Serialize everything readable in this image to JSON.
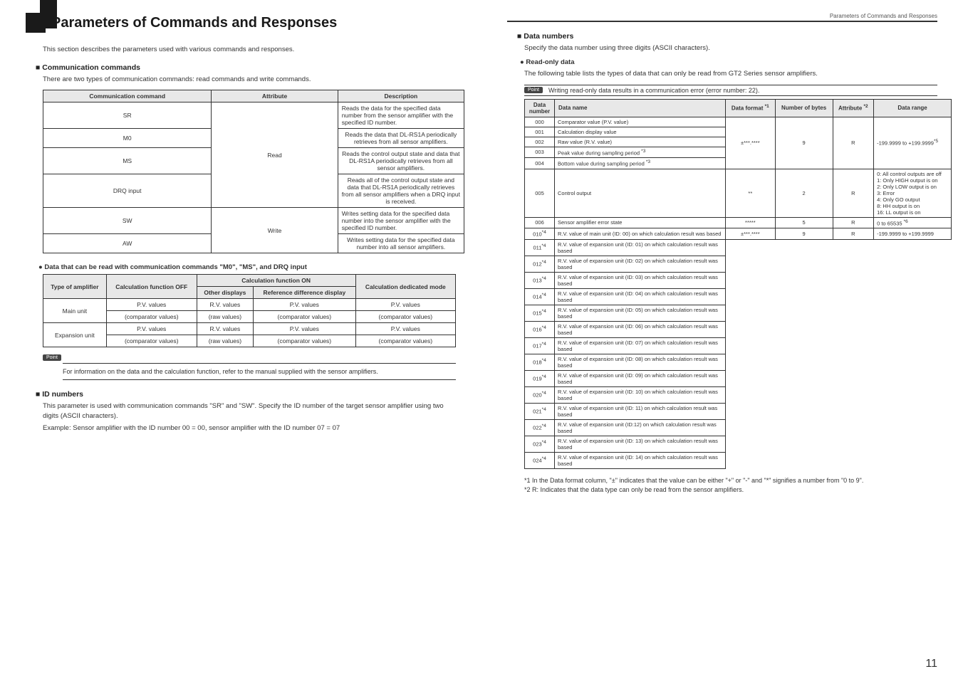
{
  "left": {
    "title": "Parameters of Commands and Responses",
    "intro": "This section describes the parameters used with various commands and responses.",
    "h_comm": "Communication commands",
    "comm_intro": "There are two types of communication commands: read commands and write commands.",
    "tbl1": {
      "h1": "Communication command",
      "h2": "Attribute",
      "h3": "Description",
      "rows": [
        {
          "c": "SR",
          "d": "Reads the data for the specified data number from the sensor amplifier with the specified ID number."
        },
        {
          "c": "M0",
          "d": "Reads the data that DL-RS1A periodically retrieves from all sensor amplifiers."
        },
        {
          "c": "MS",
          "d": "Reads the control output state and data that DL-RS1A periodically retrieves from all sensor amplifiers."
        },
        {
          "c": "DRQ input",
          "d": "Reads all of the control output state and data that DL-RS1A periodically retrieves from all sensor amplifiers when a DRQ input is received."
        }
      ],
      "attr_read": "Read",
      "write_rows": [
        {
          "c": "SW",
          "d": "Writes setting data for the specified data number into the sensor amplifier with the specified ID number."
        },
        {
          "c": "AW",
          "d": "Writes setting data for the specified data number into all sensor amplifiers."
        }
      ],
      "attr_write": "Write"
    },
    "sub_data": "Data that can be read with communication commands \"M0\", \"MS\", and DRQ input",
    "tbl2": {
      "h_type": "Type of amplifier",
      "h_calc_off": "Calculation function OFF",
      "h_calc_on": "Calculation function ON",
      "h_other": "Other displays",
      "h_ref": "Reference difference display",
      "h_dedicated": "Calculation dedicated mode",
      "r1_type": "Main unit",
      "r2_type": "Expansion unit",
      "pv": "P.V. values",
      "rv": "R.V. values",
      "comp": "(comparator values)",
      "raw": "(raw values)"
    },
    "point_label": "Point",
    "point_text": "For information on the data and the calculation function, refer to the manual supplied with the sensor amplifiers.",
    "h_id": "ID numbers",
    "id_p1": "This parameter is used with communication commands \"SR\" and \"SW\". Specify the ID number of the target sensor amplifier using two digits (ASCII characters).",
    "id_p2": "Example: Sensor amplifier with the ID number 00 = 00, sensor amplifier with the ID number 07 = 07"
  },
  "right": {
    "header": "Parameters of Commands and Responses",
    "h_data": "Data numbers",
    "data_intro": "Specify the data number using three digits (ASCII characters).",
    "sub_read": "Read-only data",
    "read_intro": "The following table lists the types of data that can only be read from GT2 Series sensor amplifiers.",
    "point_label": "Point",
    "point_text": "Writing read-only data results in a communication error (error number: 22).",
    "tbl3": {
      "h_num": "Data number",
      "h_name": "Data name",
      "h_fmt": "Data format",
      "h_fmt_sup": "*1",
      "h_bytes": "Number of bytes",
      "h_attr": "Attribute",
      "h_attr_sup": "*2",
      "h_range": "Data range",
      "g1": [
        {
          "n": "000",
          "name": "Comparator value (P.V. value)"
        },
        {
          "n": "001",
          "name": "Calculation display value"
        },
        {
          "n": "002",
          "name": "Raw value (R.V. value)"
        },
        {
          "n": "003",
          "name": "Peak value during sampling period",
          "sup": "*3"
        },
        {
          "n": "004",
          "name": "Bottom value during sampling period",
          "sup": "*3"
        }
      ],
      "g1_fmt": "±***.****",
      "g1_bytes": "9",
      "g1_attr": "R",
      "g1_range": "-199.9999 to +199.9999",
      "g1_range_sup": "*5",
      "r005": {
        "n": "005",
        "name": "Control output",
        "fmt": "**",
        "bytes": "2",
        "attr": "R",
        "range": "0: All control outputs are off\n1: Only HIGH output is on\n2: Only LOW output is on\n3: Error\n4: Only GO output\n8: HH output is on\n16: LL output is on"
      },
      "r006": {
        "n": "006",
        "name": "Sensor amplifier error state",
        "fmt": "*****",
        "bytes": "5",
        "attr": "R",
        "range": "0 to 65535",
        "range_sup": "*6"
      },
      "g2_first": {
        "n": "010",
        "sup": "*4",
        "name": "R.V. value of main unit (ID: 00) on which calculation result was based"
      },
      "g2": [
        {
          "n": "011",
          "sup": "*4",
          "name": "R.V. value of expansion unit (ID: 01) on which calculation result was based"
        },
        {
          "n": "012",
          "sup": "*4",
          "name": "R.V. value of expansion unit (ID: 02) on which calculation result was based"
        },
        {
          "n": "013",
          "sup": "*4",
          "name": "R.V. value of expansion unit (ID: 03) on which calculation result was based"
        },
        {
          "n": "014",
          "sup": "*4",
          "name": "R.V. value of expansion unit (ID: 04) on which calculation result was based"
        },
        {
          "n": "015",
          "sup": "*4",
          "name": "R.V. value of expansion unit (ID: 05) on which calculation result was based"
        },
        {
          "n": "016",
          "sup": "*4",
          "name": "R.V. value of expansion unit (ID: 06) on which calculation result was based"
        },
        {
          "n": "017",
          "sup": "*4",
          "name": "R.V. value of expansion unit (ID: 07) on which calculation result was based"
        },
        {
          "n": "018",
          "sup": "*4",
          "name": "R.V. value of expansion unit (ID: 08) on which calculation result was based"
        },
        {
          "n": "019",
          "sup": "*4",
          "name": "R.V. value of expansion unit (ID: 09) on which calculation result was based"
        },
        {
          "n": "020",
          "sup": "*4",
          "name": "R.V. value of expansion unit (ID: 10) on which calculation result was based"
        },
        {
          "n": "021",
          "sup": "*4",
          "name": "R.V. value of expansion unit (ID: 11) on which calculation result was based"
        },
        {
          "n": "022",
          "sup": "*4",
          "name": "R.V. value of expansion unit (ID:12) on which calculation result was based"
        },
        {
          "n": "023",
          "sup": "*4",
          "name": "R.V. value of expansion unit (ID: 13) on which calculation result was based"
        },
        {
          "n": "024",
          "sup": "*4",
          "name": "R.V. value of expansion unit (ID: 14) on which calculation result was based"
        }
      ],
      "g2_fmt": "±***.****",
      "g2_bytes": "9",
      "g2_attr": "R",
      "g2_range": "-199.9999 to +199.9999"
    },
    "fn1": "*1   In the Data format column, \"±\" indicates that the value can be either \"+\" or \"-\" and \"*\" signifies a number from \"0 to 9\".",
    "fn2": "*2   R: Indicates that the data type can only be read from the sensor amplifiers.",
    "page_num": "11"
  }
}
